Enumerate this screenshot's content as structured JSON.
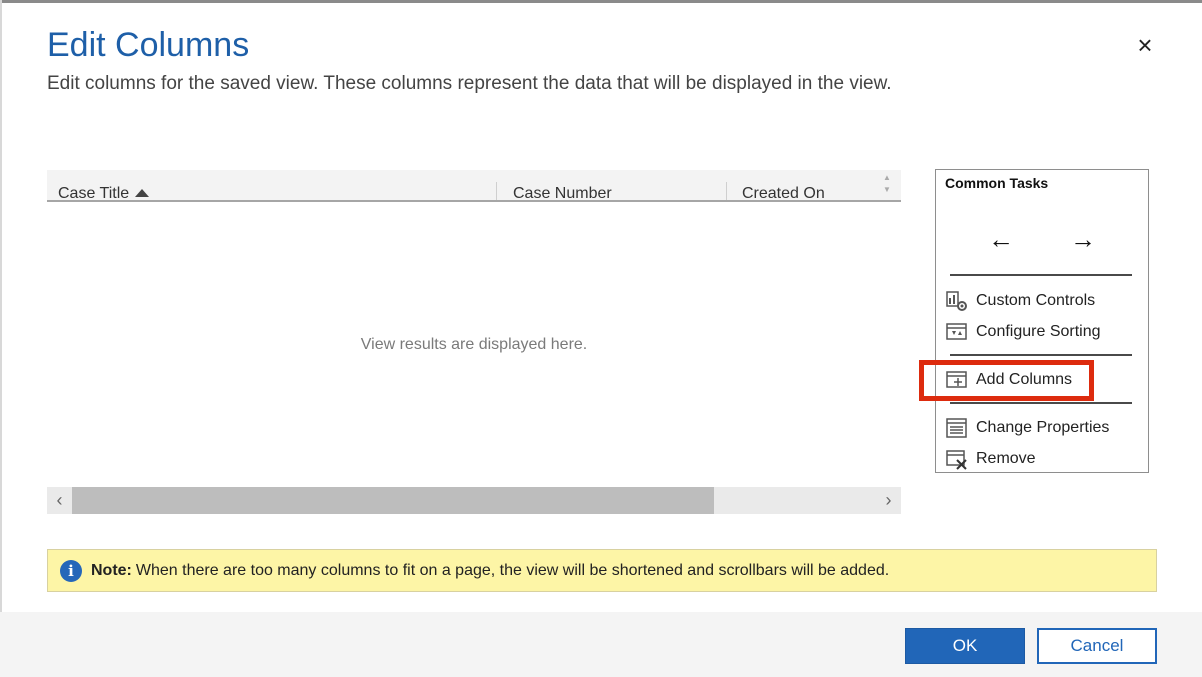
{
  "dialog": {
    "title": "Edit Columns",
    "subtitle": "Edit columns for the saved view. These columns represent the data that will be displayed in the view.",
    "close_glyph": "×"
  },
  "grid": {
    "columns": [
      "Case Title",
      "Case Number",
      "Created On"
    ],
    "sorted_column": "Case Title",
    "sort_direction": "ascending",
    "empty_message": "View results are displayed here.",
    "scroll_left_glyph": "‹",
    "scroll_right_glyph": "›"
  },
  "tasks": {
    "title": "Common Tasks",
    "move_left_glyph": "←",
    "move_right_glyph": "→",
    "items": [
      {
        "label": "Custom Controls",
        "icon": "custom-controls-icon"
      },
      {
        "label": "Configure Sorting",
        "icon": "configure-sorting-icon"
      },
      {
        "label": "Add Columns",
        "icon": "add-columns-icon"
      },
      {
        "label": "Change Properties",
        "icon": "change-properties-icon"
      },
      {
        "label": "Remove",
        "icon": "remove-icon"
      }
    ],
    "highlighted_item": "Add Columns",
    "highlight_color": "#dd2b0e"
  },
  "note": {
    "icon_glyph": "i",
    "bold": "Note:",
    "text": "When there are too many columns to fit on a page, the view will be shortened and scrollbars will be added."
  },
  "footer": {
    "ok_label": "OK",
    "cancel_label": "Cancel"
  },
  "colors": {
    "title": "#1e5fa8",
    "primary_button": "#2166b8",
    "note_background": "#fdf5a6"
  }
}
